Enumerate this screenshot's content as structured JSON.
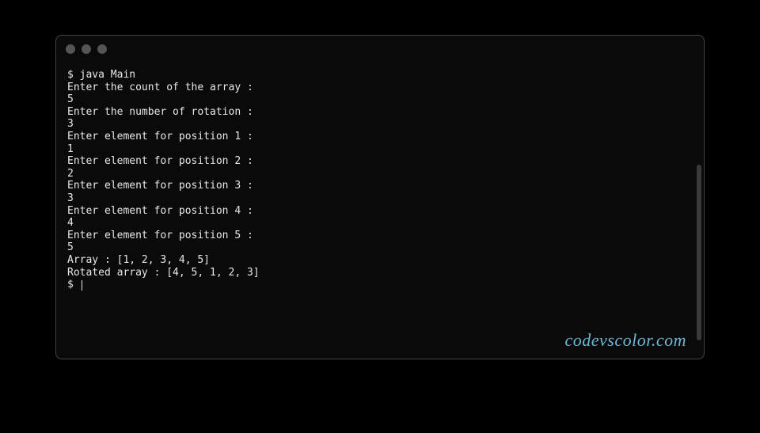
{
  "terminal": {
    "lines": [
      "$ java Main",
      "Enter the count of the array :",
      "5",
      "Enter the number of rotation :",
      "3",
      "Enter element for position 1 :",
      "1",
      "Enter element for position 2 :",
      "2",
      "Enter element for position 3 :",
      "3",
      "Enter element for position 4 :",
      "4",
      "Enter element for position 5 :",
      "5",
      "Array : [1, 2, 3, 4, 5]",
      "Rotated array : [4, 5, 1, 2, 3]"
    ],
    "final_prompt": "$ "
  },
  "watermark": "codevscolor.com"
}
